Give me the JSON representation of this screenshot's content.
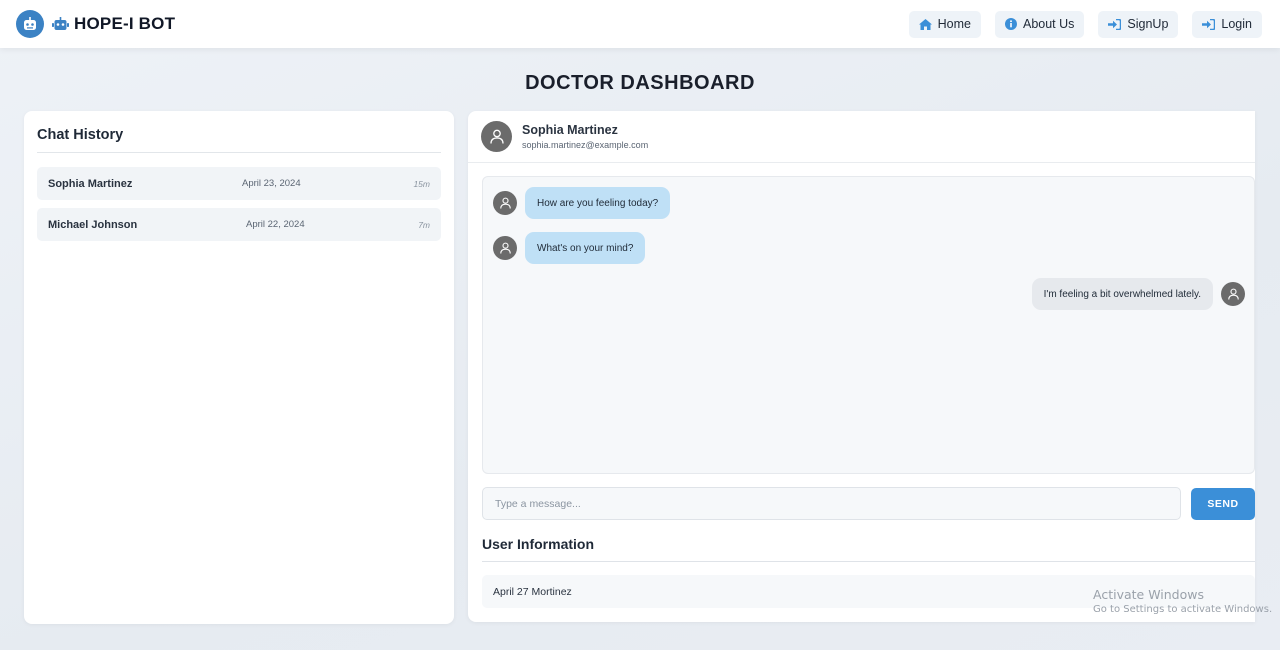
{
  "navbar": {
    "brand_title": "HOPE-I BOT",
    "links": [
      {
        "label": "Home",
        "icon": "home-icon"
      },
      {
        "label": "About Us",
        "icon": "info-icon"
      },
      {
        "label": "SignUp",
        "icon": "sign-in-icon"
      },
      {
        "label": "Login",
        "icon": "sign-in-icon"
      }
    ]
  },
  "page": {
    "title": "DOCTOR DASHBOARD"
  },
  "chat_history": {
    "heading": "Chat History",
    "items": [
      {
        "name": "Sophia Martinez",
        "date": "April 23, 2024",
        "duration": "15m"
      },
      {
        "name": "Michael Johnson",
        "date": "April 22, 2024",
        "duration": "7m"
      }
    ]
  },
  "chat": {
    "user_name": "Sophia Martinez",
    "user_email": "sophia.martinez@example.com",
    "messages": [
      {
        "direction": "incoming",
        "text": "How are you feeling today?"
      },
      {
        "direction": "incoming",
        "text": "What's on your mind?"
      },
      {
        "direction": "outgoing",
        "text": "I'm feeling a bit overwhelmed lately."
      }
    ],
    "input_placeholder": "Type a message...",
    "send_label": "SEND"
  },
  "user_information": {
    "heading": "User Information",
    "row_text": "April 27 Mortinez"
  },
  "watermark": {
    "title": "Activate Windows",
    "subtitle": "Go to Settings to activate Windows."
  },
  "colors": {
    "accent": "#3b8fd8",
    "incoming_bubble": "#bfe0f6",
    "outgoing_bubble": "#e6e9ed",
    "avatar": "#6b6b6b"
  }
}
